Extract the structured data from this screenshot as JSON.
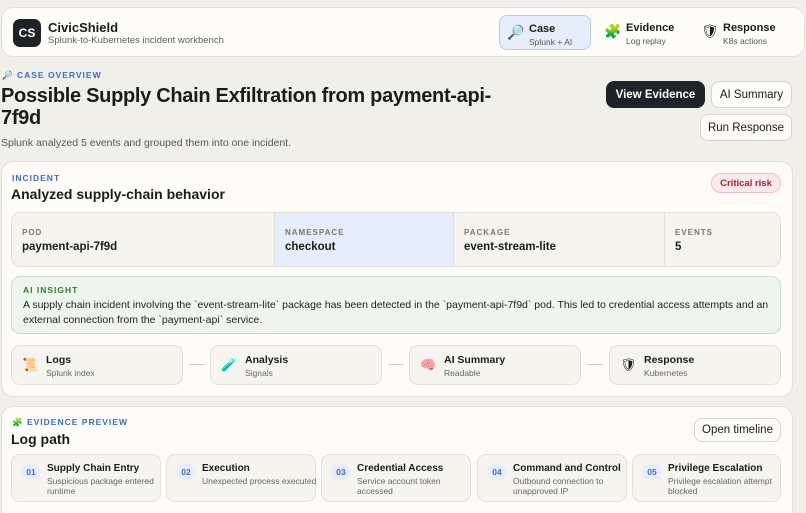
{
  "app": {
    "logo": "CS",
    "name": "CivicShield",
    "subtitle": "Splunk-to-Kubernetes incident workbench"
  },
  "nav": [
    {
      "icon": "🔎",
      "icon_name": "magnifier-icon",
      "label": "Case",
      "sub": "Splunk + AI",
      "active": true
    },
    {
      "icon": "🧩",
      "icon_name": "puzzle-icon",
      "label": "Evidence",
      "sub": "Log replay",
      "active": false
    },
    {
      "icon": "🛡",
      "icon_name": "shield-icon",
      "label": "Response",
      "sub": "K8s actions",
      "active": false
    }
  ],
  "overview": {
    "eyebrow_icon": "🔎",
    "eyebrow": "CASE OVERVIEW",
    "title": "Possible Supply Chain Exfiltration from payment-api-7f9d",
    "subtitle": "Splunk analyzed 5 events and grouped them into one incident.",
    "buttons": {
      "view_evidence": "View Evidence",
      "ai_summary": "AI Summary",
      "run_response": "Run Response"
    }
  },
  "incident": {
    "eyebrow": "INCIDENT",
    "title": "Analyzed supply-chain behavior",
    "badge": "Critical risk",
    "facts": [
      {
        "label": "POD",
        "value": "payment-api-7f9d"
      },
      {
        "label": "NAMESPACE",
        "value": "checkout"
      },
      {
        "label": "PACKAGE",
        "value": "event-stream-lite"
      },
      {
        "label": "EVENTS",
        "value": "5"
      }
    ],
    "insight_label": "AI INSIGHT",
    "insight_text": "A supply chain incident involving the `event-stream-lite` package has been detected in the `payment-api-7f9d` pod. This led to credential access attempts and an external connection from the `payment-api` service.",
    "pipeline": [
      {
        "icon": "📜",
        "icon_name": "scroll-icon",
        "label": "Logs",
        "sub": "Splunk index"
      },
      {
        "icon": "🧪",
        "icon_name": "test-tube-icon",
        "label": "Analysis",
        "sub": "Signals"
      },
      {
        "icon": "🧠",
        "icon_name": "brain-icon",
        "label": "AI Summary",
        "sub": "Readable"
      },
      {
        "icon": "🛡",
        "icon_name": "shield-icon",
        "label": "Response",
        "sub": "Kubernetes"
      }
    ]
  },
  "evidence": {
    "eyebrow_icon": "🧩",
    "eyebrow": "EVIDENCE PREVIEW",
    "title": "Log path",
    "timeline_button": "Open timeline",
    "steps": [
      {
        "num": "01",
        "title": "Supply Chain Entry",
        "sub": "Suspicious package entered runtime"
      },
      {
        "num": "02",
        "title": "Execution",
        "sub": "Unexpected process executed"
      },
      {
        "num": "03",
        "title": "Credential Access",
        "sub": "Service account token accessed"
      },
      {
        "num": "04",
        "title": "Command and Control",
        "sub": "Outbound connection to unapproved IP"
      },
      {
        "num": "05",
        "title": "Privilege Escalation",
        "sub": "Privilege escalation attempt blocked"
      }
    ]
  },
  "colors": {
    "accent": "#3b6cc7",
    "critical": "#a32035",
    "insight": "#2f7d3a",
    "primary": "#1f2328"
  }
}
